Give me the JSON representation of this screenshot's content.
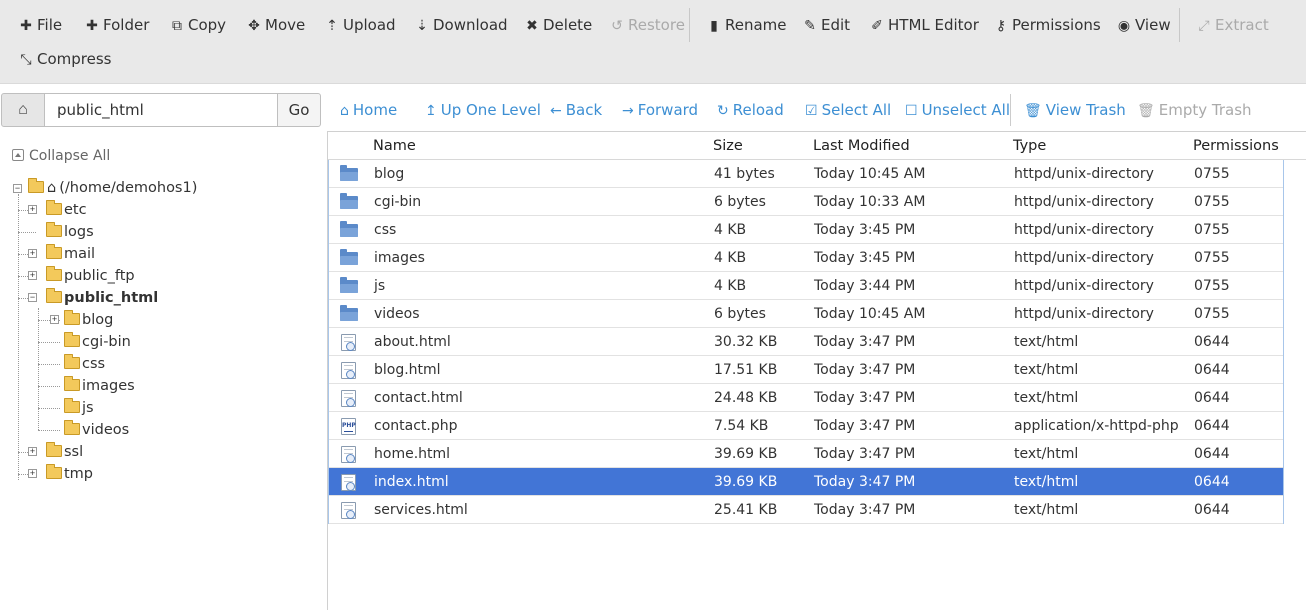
{
  "toolbar": {
    "row1": [
      {
        "key": "file",
        "label": "File",
        "icon": "plus-icon",
        "glyph": "✚",
        "disabled": false
      },
      {
        "key": "folder",
        "label": "Folder",
        "icon": "plus-icon",
        "glyph": "✚",
        "disabled": false
      },
      {
        "key": "copy",
        "label": "Copy",
        "icon": "copy-icon",
        "glyph": "⧉",
        "disabled": false
      },
      {
        "key": "move",
        "label": "Move",
        "icon": "move-arrows-icon",
        "glyph": "✥",
        "disabled": false
      },
      {
        "key": "upload",
        "label": "Upload",
        "icon": "upload-icon",
        "glyph": "⇡",
        "disabled": false
      },
      {
        "key": "download",
        "label": "Download",
        "icon": "download-icon",
        "glyph": "⇣",
        "disabled": false
      },
      {
        "key": "delete",
        "label": "Delete",
        "icon": "times-icon",
        "glyph": "✖",
        "disabled": false
      },
      {
        "key": "restore",
        "label": "Restore",
        "icon": "undo-icon",
        "glyph": "↺",
        "disabled": true
      },
      {
        "key": "rename",
        "label": "Rename",
        "icon": "file-icon",
        "glyph": "▮",
        "disabled": false
      },
      {
        "key": "edit",
        "label": "Edit",
        "icon": "pencil-icon",
        "glyph": "✎",
        "disabled": false
      },
      {
        "key": "html_editor",
        "label": "HTML Editor",
        "icon": "edit-box-icon",
        "glyph": "✐",
        "disabled": false
      },
      {
        "key": "permissions",
        "label": "Permissions",
        "icon": "key-icon",
        "glyph": "⚷",
        "disabled": false
      },
      {
        "key": "view",
        "label": "View",
        "icon": "eye-icon",
        "glyph": "◉",
        "disabled": false
      },
      {
        "key": "extract",
        "label": "Extract",
        "icon": "expand-icon",
        "glyph": "⤢",
        "disabled": true
      }
    ],
    "row2": [
      {
        "key": "compress",
        "label": "Compress",
        "icon": "compress-icon",
        "glyph": "⤡",
        "disabled": false
      }
    ]
  },
  "pathbar": {
    "home_icon": "home-icon",
    "path_value": "public_html",
    "go_label": "Go"
  },
  "nav": [
    {
      "key": "home",
      "label": "Home",
      "icon": "home-icon",
      "glyph": "⌂",
      "disabled": false
    },
    {
      "key": "up",
      "label": "Up One Level",
      "icon": "level-up-icon",
      "glyph": "↥",
      "disabled": false
    },
    {
      "key": "back",
      "label": "Back",
      "icon": "arrow-left-icon",
      "glyph": "←",
      "disabled": false
    },
    {
      "key": "forward",
      "label": "Forward",
      "icon": "arrow-right-icon",
      "glyph": "→",
      "disabled": false
    },
    {
      "key": "reload",
      "label": "Reload",
      "icon": "refresh-icon",
      "glyph": "↻",
      "disabled": false
    },
    {
      "key": "select_all",
      "label": "Select All",
      "icon": "checkbox-checked-icon",
      "glyph": "☑",
      "disabled": false
    },
    {
      "key": "unselect_all",
      "label": "Unselect All",
      "icon": "checkbox-empty-icon",
      "glyph": "☐",
      "disabled": false
    },
    {
      "key": "view_trash",
      "label": "View Trash",
      "icon": "trash-icon",
      "glyph": "🗑",
      "disabled": false
    },
    {
      "key": "empty_trash",
      "label": "Empty Trash",
      "icon": "trash-icon",
      "glyph": "🗑",
      "disabled": true
    }
  ],
  "tree": {
    "collapse_all": "Collapse All",
    "root": "(/home/demohos1)",
    "nodes": [
      {
        "label": "etc",
        "expandable": true,
        "bold": false
      },
      {
        "label": "logs",
        "expandable": false,
        "bold": false
      },
      {
        "label": "mail",
        "expandable": true,
        "bold": false
      },
      {
        "label": "public_ftp",
        "expandable": true,
        "bold": false
      },
      {
        "label": "public_html",
        "expandable": true,
        "expanded": true,
        "bold": true
      },
      {
        "label": "blog",
        "expandable": true,
        "bold": false,
        "child": true
      },
      {
        "label": "cgi-bin",
        "expandable": false,
        "bold": false,
        "child": true
      },
      {
        "label": "css",
        "expandable": false,
        "bold": false,
        "child": true
      },
      {
        "label": "images",
        "expandable": false,
        "bold": false,
        "child": true
      },
      {
        "label": "js",
        "expandable": false,
        "bold": false,
        "child": true
      },
      {
        "label": "videos",
        "expandable": false,
        "bold": false,
        "child": true
      },
      {
        "label": "ssl",
        "expandable": true,
        "bold": false
      },
      {
        "label": "tmp",
        "expandable": true,
        "bold": false
      }
    ]
  },
  "table": {
    "columns": [
      "Name",
      "Size",
      "Last Modified",
      "Type",
      "Permissions"
    ],
    "selected_color": "#4275d6",
    "rows": [
      {
        "icon": "folder-icon",
        "kind": "dir",
        "name": "blog",
        "size": "41 bytes",
        "modified": "Today 10:45 AM",
        "type": "httpd/unix-directory",
        "perms": "0755",
        "selected": false
      },
      {
        "icon": "folder-icon",
        "kind": "dir",
        "name": "cgi-bin",
        "size": "6 bytes",
        "modified": "Today 10:33 AM",
        "type": "httpd/unix-directory",
        "perms": "0755",
        "selected": false
      },
      {
        "icon": "folder-icon",
        "kind": "dir",
        "name": "css",
        "size": "4 KB",
        "modified": "Today 3:45 PM",
        "type": "httpd/unix-directory",
        "perms": "0755",
        "selected": false
      },
      {
        "icon": "folder-icon",
        "kind": "dir",
        "name": "images",
        "size": "4 KB",
        "modified": "Today 3:45 PM",
        "type": "httpd/unix-directory",
        "perms": "0755",
        "selected": false
      },
      {
        "icon": "folder-icon",
        "kind": "dir",
        "name": "js",
        "size": "4 KB",
        "modified": "Today 3:44 PM",
        "type": "httpd/unix-directory",
        "perms": "0755",
        "selected": false
      },
      {
        "icon": "folder-icon",
        "kind": "dir",
        "name": "videos",
        "size": "6 bytes",
        "modified": "Today 10:45 AM",
        "type": "httpd/unix-directory",
        "perms": "0755",
        "selected": false
      },
      {
        "icon": "html-file-icon",
        "kind": "html",
        "name": "about.html",
        "size": "30.32 KB",
        "modified": "Today 3:47 PM",
        "type": "text/html",
        "perms": "0644",
        "selected": false
      },
      {
        "icon": "html-file-icon",
        "kind": "html",
        "name": "blog.html",
        "size": "17.51 KB",
        "modified": "Today 3:47 PM",
        "type": "text/html",
        "perms": "0644",
        "selected": false
      },
      {
        "icon": "html-file-icon",
        "kind": "html",
        "name": "contact.html",
        "size": "24.48 KB",
        "modified": "Today 3:47 PM",
        "type": "text/html",
        "perms": "0644",
        "selected": false
      },
      {
        "icon": "php-file-icon",
        "kind": "php",
        "name": "contact.php",
        "size": "7.54 KB",
        "modified": "Today 3:47 PM",
        "type": "application/x-httpd-php",
        "perms": "0644",
        "selected": false,
        "icon_text": "PHP"
      },
      {
        "icon": "html-file-icon",
        "kind": "html",
        "name": "home.html",
        "size": "39.69 KB",
        "modified": "Today 3:47 PM",
        "type": "text/html",
        "perms": "0644",
        "selected": false
      },
      {
        "icon": "html-file-icon",
        "kind": "html",
        "name": "index.html",
        "size": "39.69 KB",
        "modified": "Today 3:47 PM",
        "type": "text/html",
        "perms": "0644",
        "selected": true
      },
      {
        "icon": "html-file-icon",
        "kind": "html",
        "name": "services.html",
        "size": "25.41 KB",
        "modified": "Today 3:47 PM",
        "type": "text/html",
        "perms": "0644",
        "selected": false
      }
    ]
  }
}
